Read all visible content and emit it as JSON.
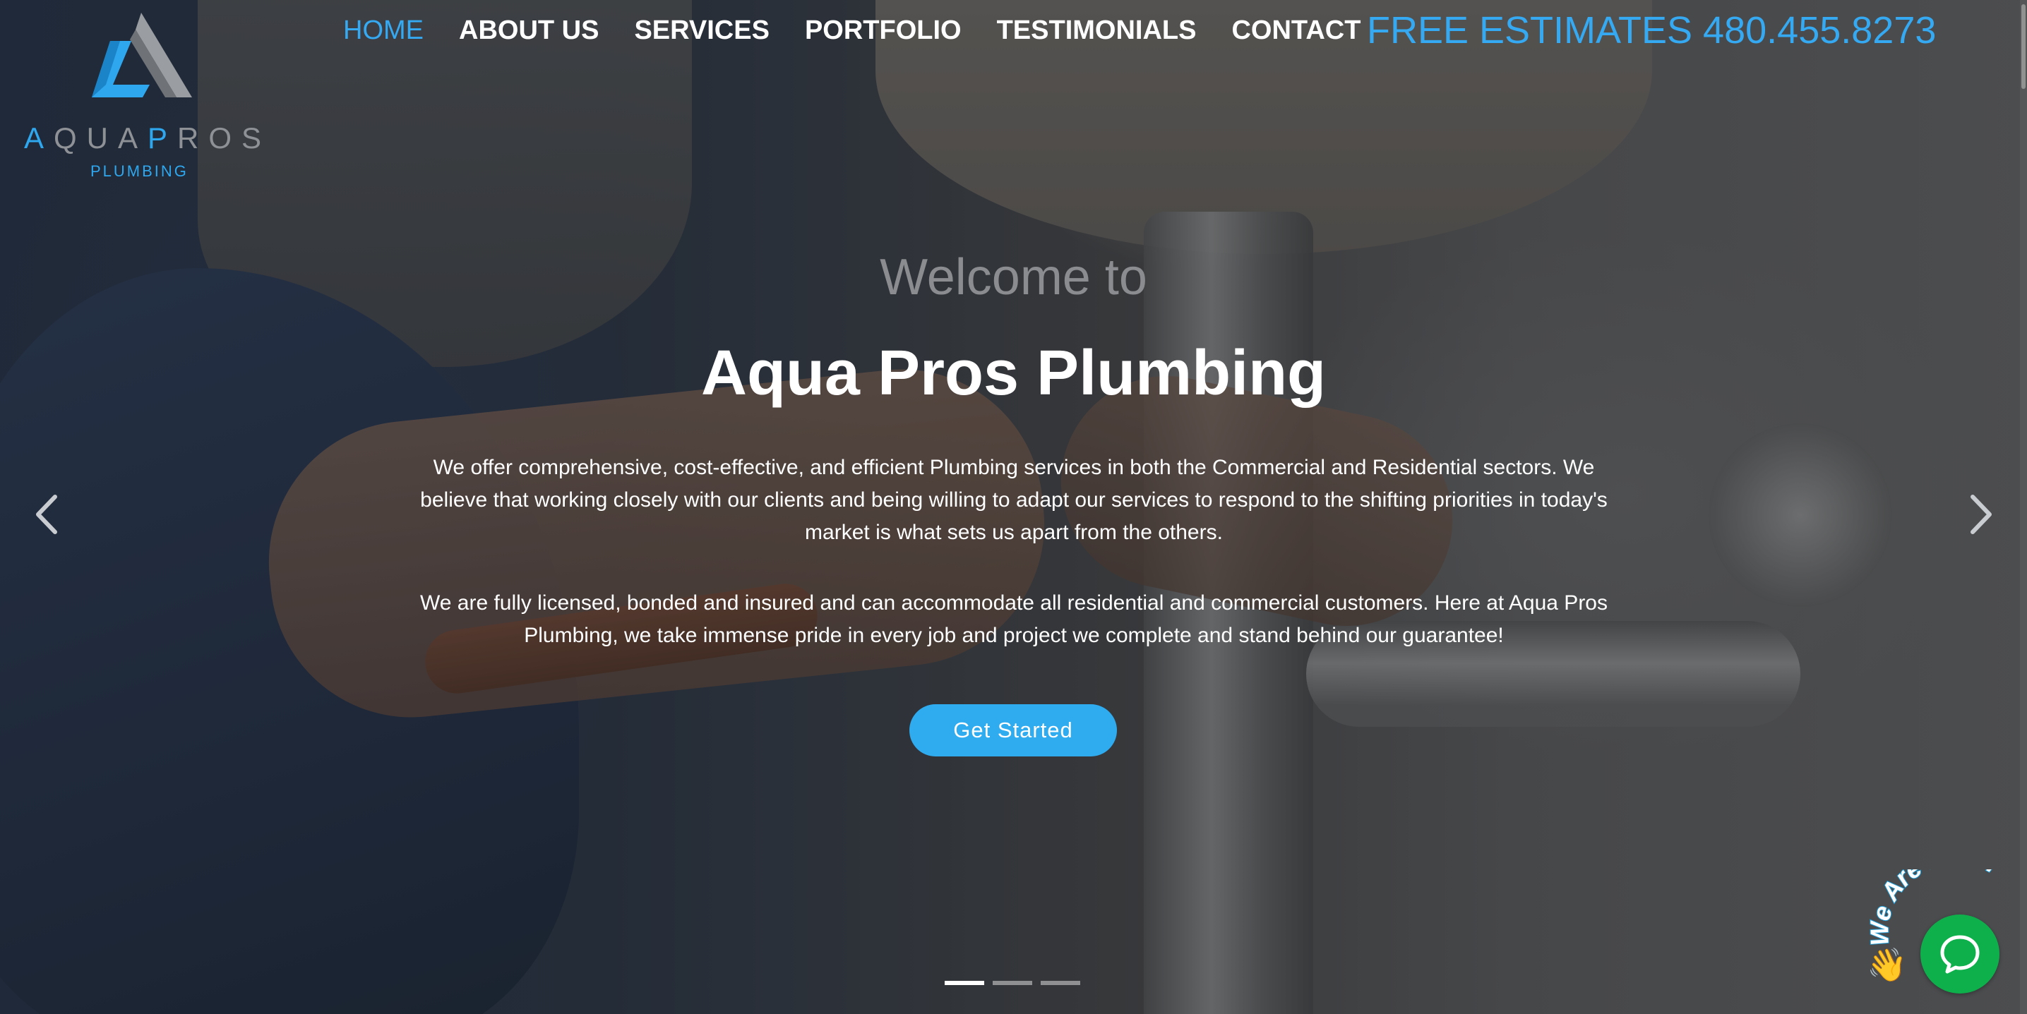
{
  "brand": {
    "name_part1": "A",
    "name_part2": "QUA",
    "name_part3": "P",
    "name_part4": "ROS",
    "subtitle": "PLUMBING",
    "accent_color": "#35aaf3"
  },
  "nav": {
    "items": [
      {
        "label": "HOME",
        "active": true
      },
      {
        "label": "ABOUT US",
        "active": false
      },
      {
        "label": "SERVICES",
        "active": false
      },
      {
        "label": "PORTFOLIO",
        "active": false
      },
      {
        "label": "TESTIMONIALS",
        "active": false
      },
      {
        "label": "CONTACT",
        "active": false
      }
    ],
    "phone_label": "FREE ESTIMATES 480.455.8273"
  },
  "hero": {
    "welcome": "Welcome to",
    "title": "Aqua Pros Plumbing",
    "paragraph1": "We offer comprehensive, cost-effective, and efficient Plumbing services in both the Commercial and Residential sectors. We believe that working closely with our clients and being willing to adapt our services to respond to the shifting priorities in today's market is what sets us apart from the others.",
    "paragraph2": "We are fully licensed, bonded and insured and can accommodate all residential and commercial customers. Here at Aqua Pros Plumbing, we take immense pride in every job and project we complete and stand behind our guarantee!",
    "cta_label": "Get Started",
    "cta_color": "#2fabf0",
    "slide_count": 3,
    "active_slide": 1,
    "prev_icon": "chevron-left-icon",
    "next_icon": "chevron-right-icon"
  },
  "chat": {
    "badge_text": "We Are Here!",
    "icon": "chat-bubble-icon",
    "hand_icon": "waving-hand-icon",
    "color": "#0db04b"
  }
}
